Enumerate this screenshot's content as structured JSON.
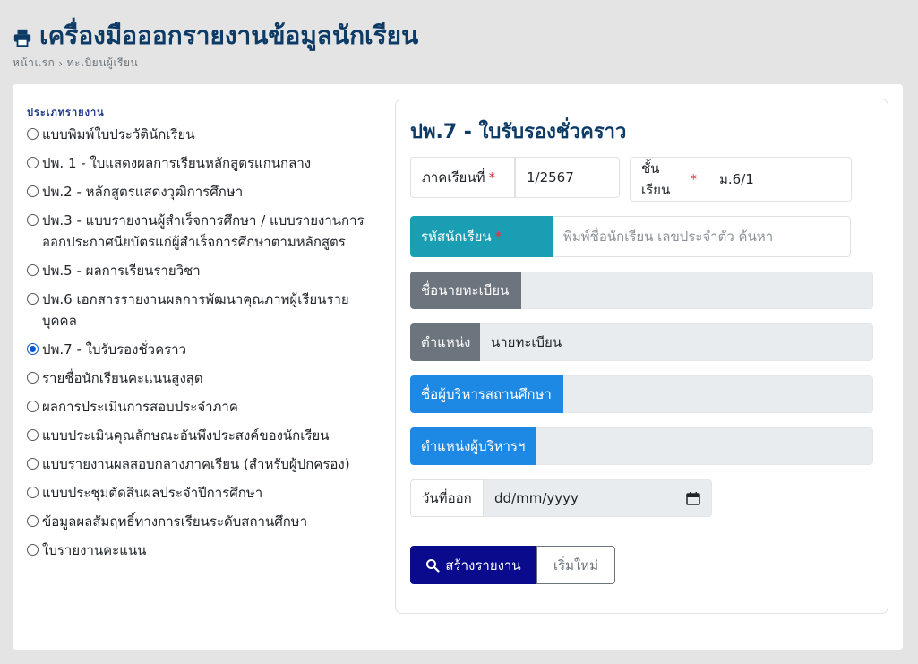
{
  "header": {
    "title": "เครื่องมือออกรายงานข้อมูลนักเรียน",
    "breadcrumb": {
      "home": "หน้าแรก",
      "current": "ทะเบียนผู้เรียน"
    }
  },
  "report_types": {
    "section_label": "ประเภทรายงาน",
    "items": [
      {
        "label": "แบบพิมพ์ใบประวัตินักเรียน",
        "checked": false
      },
      {
        "label": "ปพ. 1 - ใบแสดงผลการเรียนหลักสูตรแกนกลาง",
        "checked": false
      },
      {
        "label": "ปพ.2 - หลักสูตรแสดงวุฒิการศึกษา",
        "checked": false
      },
      {
        "label": "ปพ.3 - แบบรายงานผู้สำเร็จการศึกษา / แบบรายงานการออกประกาศนียบัตรแก่ผู้สำเร็จการศึกษาตามหลักสูตร",
        "checked": false
      },
      {
        "label": "ปพ.5 - ผลการเรียนรายวิชา",
        "checked": false
      },
      {
        "label": "ปพ.6 เอกสารรายงานผลการพัฒนาคุณภาพผู้เรียนรายบุคคล",
        "checked": false
      },
      {
        "label": "ปพ.7 - ใบรับรองชั่วคราว",
        "checked": true
      },
      {
        "label": "รายชื่อนักเรียนคะแนนสูงสุด",
        "checked": false
      },
      {
        "label": "ผลการประเมินการสอบประจำภาค",
        "checked": false
      },
      {
        "label": "แบบประเมินคุณลักษณะอันพึงประสงค์ของนักเรียน",
        "checked": false
      },
      {
        "label": "แบบรายงานผลสอบกลางภาคเรียน (สำหรับผู้ปกครอง)",
        "checked": false
      },
      {
        "label": "แบบประชุมตัดสินผลประจำปีการศึกษา",
        "checked": false
      },
      {
        "label": "ข้อมูลผลสัมฤทธิ์ทางการเรียนระดับสถานศึกษา",
        "checked": false
      },
      {
        "label": "ใบรายงานคะแนน",
        "checked": false
      }
    ]
  },
  "form": {
    "title": "ปพ.7 - ใบรับรองชั่วคราว",
    "semester_label": "ภาคเรียนที่",
    "semester_value": "1/2567",
    "class_label": "ชั้นเรียน",
    "class_value": "ม.6/1",
    "required_mark": "*",
    "student_id_label": "รหัสนักเรียน",
    "student_id_placeholder": "พิมพ์ชื่อนักเรียน เลขประจำตัว ค้นหา",
    "registrar_name_label": "ชื่อนายทะเบียน",
    "registrar_name_value": "",
    "position_label": "ตำแหน่ง",
    "position_value": "นายทะเบียน",
    "director_name_label": "ชื่อผู้บริหารสถานศึกษา",
    "director_name_value": "",
    "director_position_label": "ตำแหน่งผู้บริหารฯ",
    "director_position_value": "",
    "issue_date_label": "วันที่ออก",
    "issue_date_value": "dd/mm/yyyy",
    "submit_label": "สร้างรายงาน",
    "reset_label": "เริ่มใหม่"
  },
  "colors": {
    "primary": "#0a0a8c",
    "teal": "#1a9eb3",
    "gray": "#6c757d",
    "blue": "#1e88e5",
    "title": "#0d3b66"
  },
  "icons": {
    "title_icon": "printer-icon",
    "submit_icon": "search-icon",
    "date_icon": "calendar-icon"
  }
}
